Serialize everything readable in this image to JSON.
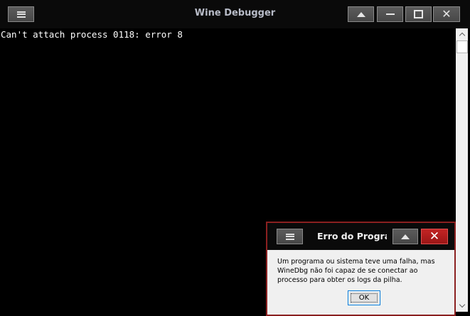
{
  "main_window": {
    "title": "Wine Debugger",
    "console_text": "Can't attach process 0118: error 8",
    "titlebar_buttons": {
      "menu_icon": "hamburger-icon",
      "rollup_icon": "triangle-up-icon",
      "minimize_icon": "minimize-icon",
      "maximize_icon": "maximize-icon",
      "close_icon": "close-icon"
    }
  },
  "dialog": {
    "title": "Erro do Programa",
    "message": "Um programa ou sistema teve uma falha, mas WineDbg não foi capaz de se conectar ao processo para obter os logs da pilha.",
    "ok_label": "OK",
    "close_button_color": "#b01c1c",
    "border_color": "#8b2020"
  },
  "colors": {
    "titlebar_bg": "#0a0a0a",
    "console_bg": "#000000",
    "console_text": "#ffffff",
    "title_text": "#b8bcc8"
  }
}
